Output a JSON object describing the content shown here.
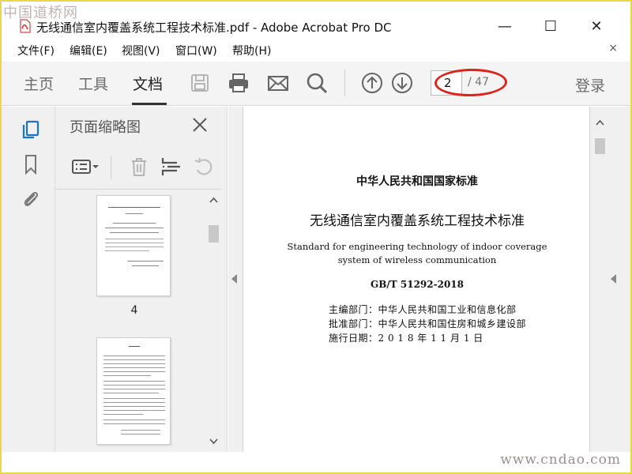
{
  "app": {
    "logo_text": "中国道桥网",
    "title": "无线通信室内覆盖系统工程技术标准.pdf - Adobe Acrobat Pro DC",
    "controls": {
      "minimize": "—",
      "maximize": "☐",
      "close": "✕"
    }
  },
  "menu": {
    "items": [
      "文件(F)",
      "编辑(E)",
      "视图(V)",
      "窗口(W)",
      "帮助(H)"
    ],
    "close": "×"
  },
  "toolbar": {
    "tabs": [
      "主页",
      "工具",
      "文档"
    ],
    "active_tab": "文档",
    "icons": [
      "save-icon",
      "print-icon",
      "email-icon",
      "search-icon",
      "page-up-icon",
      "page-down-icon"
    ],
    "page_current": "2",
    "page_total": "/ 47",
    "login": "登录"
  },
  "side_nav": {
    "icons": [
      "page-thumbnails-icon",
      "bookmark-icon",
      "attachment-icon"
    ]
  },
  "thumbnail_panel": {
    "title": "页面缩略图",
    "tools": [
      "thumbnail-options-icon",
      "delete-icon",
      "extract-icon",
      "rotate-icon"
    ],
    "pages": [
      {
        "label": "4"
      },
      {
        "label": ""
      }
    ]
  },
  "document": {
    "header": "中华人民共和国国家标准",
    "title_zh": "无线通信室内覆盖系统工程技术标准",
    "title_en_line1": "Standard for engineering technology of indoor coverage",
    "title_en_line2": "system of wireless communication",
    "code": "GB/T 51292-2018",
    "meta": [
      "主编部门：中华人民共和国工业和信息化部",
      "批准部门：中华人民共和国住房和城乡建设部",
      "施行日期：2 0 1 8 年 1 1 月 1 日"
    ]
  },
  "watermark": "www.cndao.com",
  "colors": {
    "frame": "#e8d94a",
    "highlight_oval": "#d8261c",
    "nav_active": "#1a73c9"
  }
}
